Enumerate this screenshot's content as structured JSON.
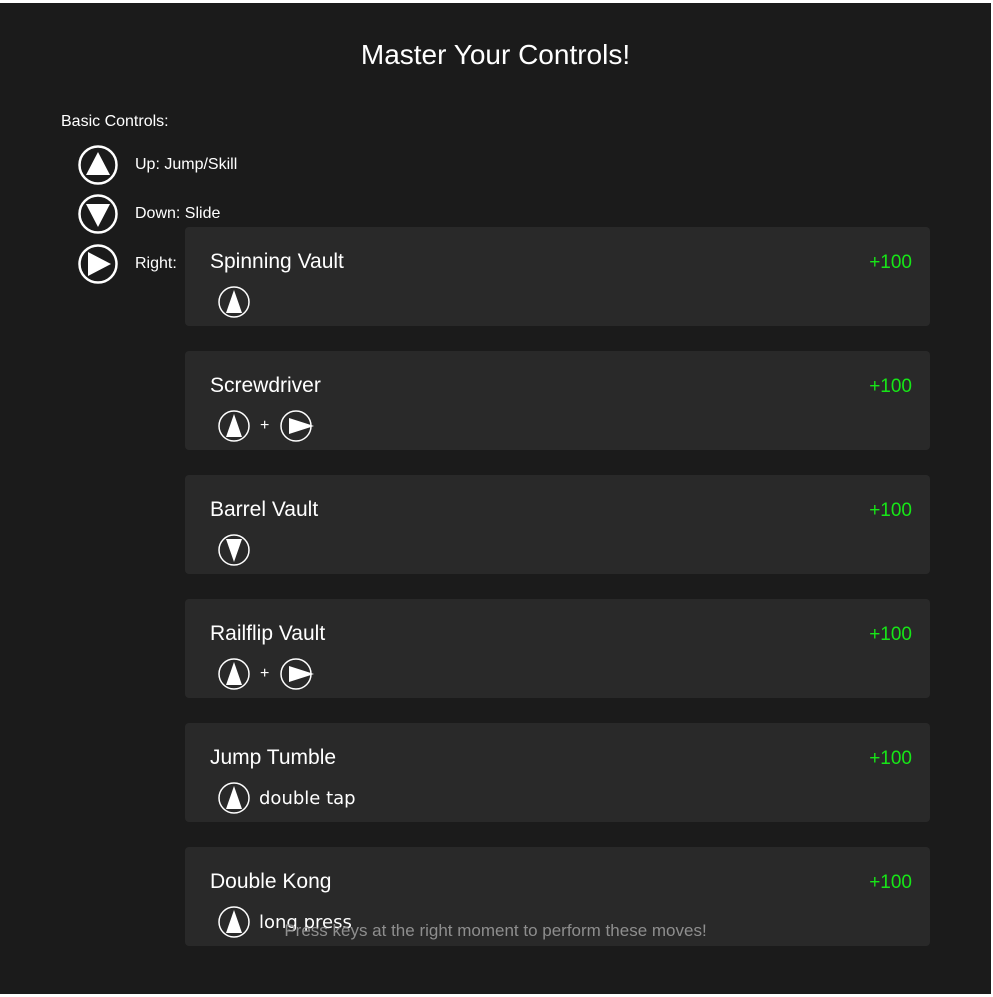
{
  "title": "Master Your Controls!",
  "basic_controls": {
    "label": "Basic Controls:",
    "items": [
      {
        "icon": "up-arrow-icon",
        "label": "Up: Jump/Skill"
      },
      {
        "icon": "down-arrow-icon",
        "label": "Down: Slide"
      },
      {
        "icon": "right-arrow-icon",
        "label": "Right:"
      }
    ]
  },
  "moves": [
    {
      "name": "Spinning Vault",
      "points": "+100",
      "keys": [
        "up-arrow-icon"
      ],
      "note": ""
    },
    {
      "name": "Screwdriver",
      "points": "+100",
      "keys": [
        "up-arrow-icon",
        "right-arrow-icon"
      ],
      "plus": "+",
      "note": ""
    },
    {
      "name": "Barrel Vault",
      "points": "+100",
      "keys": [
        "down-arrow-icon"
      ],
      "note": ""
    },
    {
      "name": "Railflip Vault",
      "points": "+100",
      "keys": [
        "up-arrow-icon",
        "right-arrow-icon"
      ],
      "plus": "+",
      "note": ""
    },
    {
      "name": "Jump Tumble",
      "points": "+100",
      "keys": [
        "up-arrow-icon"
      ],
      "note": "double tap"
    },
    {
      "name": "Double Kong",
      "points": "+100",
      "keys": [
        "up-arrow-icon"
      ],
      "note": "long press"
    }
  ],
  "footer": "Press keys at the right moment to perform these moves!",
  "colors": {
    "background": "#1b1b1b",
    "card": "#292929",
    "points": "#17e617",
    "footer": "#8e8e8e"
  }
}
